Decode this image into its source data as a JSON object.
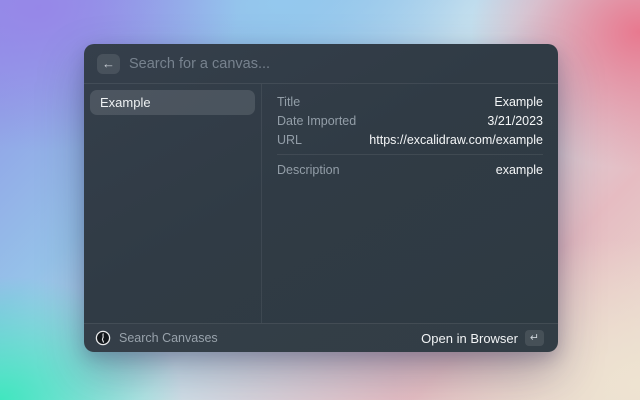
{
  "search": {
    "placeholder": "Search for a canvas...",
    "value": ""
  },
  "icons": {
    "back_arrow": "←",
    "return_key": "↵"
  },
  "list": {
    "items": [
      {
        "label": "Example",
        "selected": true
      }
    ]
  },
  "details": {
    "rows": [
      {
        "label": "Title",
        "value": "Example"
      },
      {
        "label": "Date Imported",
        "value": "3/21/2023"
      },
      {
        "label": "URL",
        "value": "https://excalidraw.com/example"
      },
      {
        "label": "Description",
        "value": "example"
      }
    ]
  },
  "footer": {
    "command_name": "Search Canvases",
    "primary_action": "Open in Browser"
  },
  "colors": {
    "window_bg": "#303b45",
    "selected_item_bg": "rgba(255,255,255,0.12)",
    "label_gray": "#939ea8",
    "value_white": "#f4f6f7",
    "bg_purple": "#9786e8",
    "bg_blue": "#94c9ee",
    "bg_pink": "#e9748b",
    "bg_teal": "#3ee7be",
    "bg_beige": "#eee3d1"
  }
}
